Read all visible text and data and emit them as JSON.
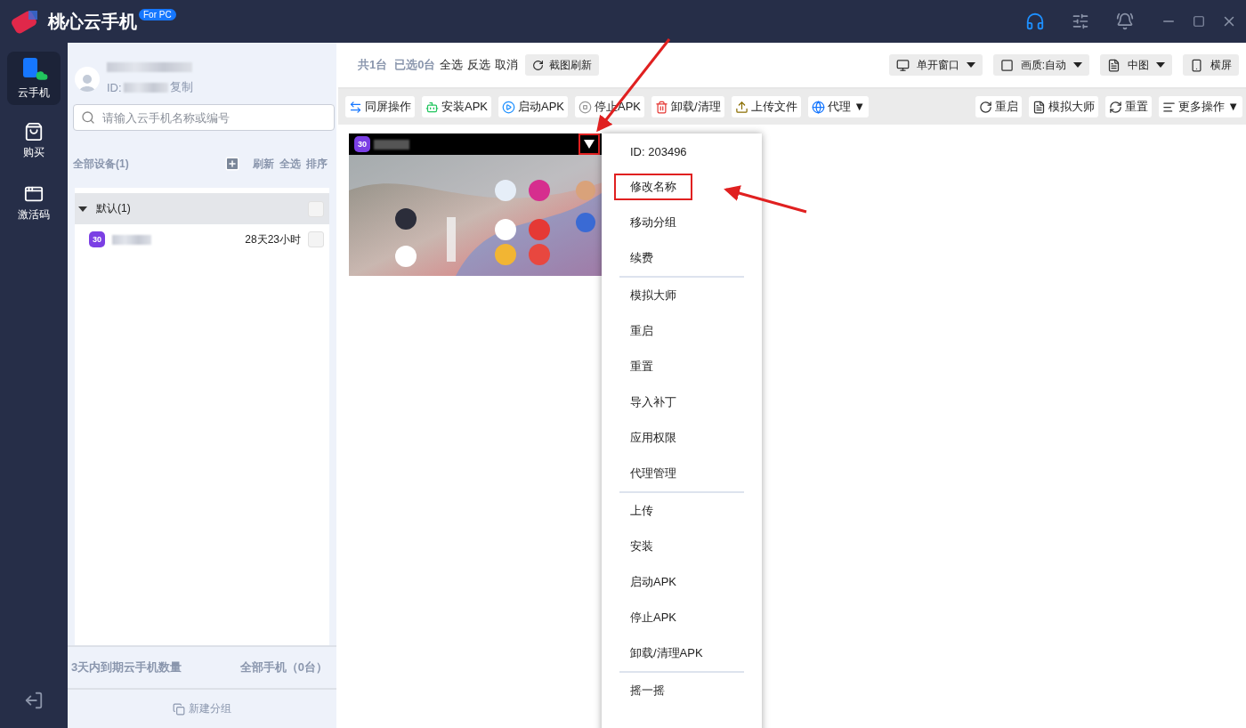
{
  "app": {
    "title": "桃心云手机",
    "badge": "For PC"
  },
  "nav": [
    {
      "label": "云手机",
      "selected": true
    },
    {
      "label": "购买",
      "selected": false
    },
    {
      "label": "激活码",
      "selected": false
    }
  ],
  "account": {
    "id_label": "ID:",
    "copy": "复制"
  },
  "search": {
    "placeholder": "请输入云手机名称或编号"
  },
  "devices_header": {
    "title": "全部设备(1)",
    "actions": [
      "刷新",
      "全选",
      "排序"
    ]
  },
  "groups": [
    {
      "label": "默认(1)",
      "expanded": true,
      "checked": false,
      "children": [
        {
          "badge": "30",
          "remaining": "28天23小时",
          "checked": false
        }
      ]
    }
  ],
  "footer": {
    "expiring": "3天内到期云手机数量",
    "all": "全部手机（0台）",
    "new_group": "新建分组"
  },
  "summary": {
    "total": "共1台",
    "selected": "已选0台",
    "links": [
      "全选",
      "反选",
      "取消"
    ],
    "refresh": "截图刷新"
  },
  "view_options": [
    "单开窗口",
    "画质:自动",
    "中图",
    "横屏"
  ],
  "actions_left": [
    "同屏操作",
    "安装APK",
    "启动APK",
    "停止APK",
    "卸载/清理",
    "上传文件",
    "代理 ▼"
  ],
  "actions_right": [
    "重启",
    "模拟大师",
    "重置",
    "更多操作 ▼"
  ],
  "phones": [
    {
      "badge": "30",
      "annotated": true,
      "kind": "picture"
    }
  ],
  "menu": [
    [
      {
        "label": "ID: 203496",
        "annotated": false
      },
      {
        "label": "修改名称",
        "annotated": true
      },
      {
        "label": "移动分组",
        "annotated": false
      },
      {
        "label": "续费",
        "annotated": false
      }
    ],
    [
      {
        "label": "模拟大师",
        "annotated": false
      },
      {
        "label": "重启",
        "annotated": false
      },
      {
        "label": "重置",
        "annotated": false
      },
      {
        "label": "导入补丁",
        "annotated": false
      },
      {
        "label": "应用权限",
        "annotated": false
      },
      {
        "label": "代理管理",
        "annotated": false
      }
    ],
    [
      {
        "label": "上传",
        "annotated": false
      },
      {
        "label": "安装",
        "annotated": false
      },
      {
        "label": "启动APK",
        "annotated": false
      },
      {
        "label": "停止APK",
        "annotated": false
      },
      {
        "label": "卸载/清理APK",
        "annotated": false
      }
    ],
    [
      {
        "label": "摇一摇",
        "annotated": false
      }
    ]
  ]
}
